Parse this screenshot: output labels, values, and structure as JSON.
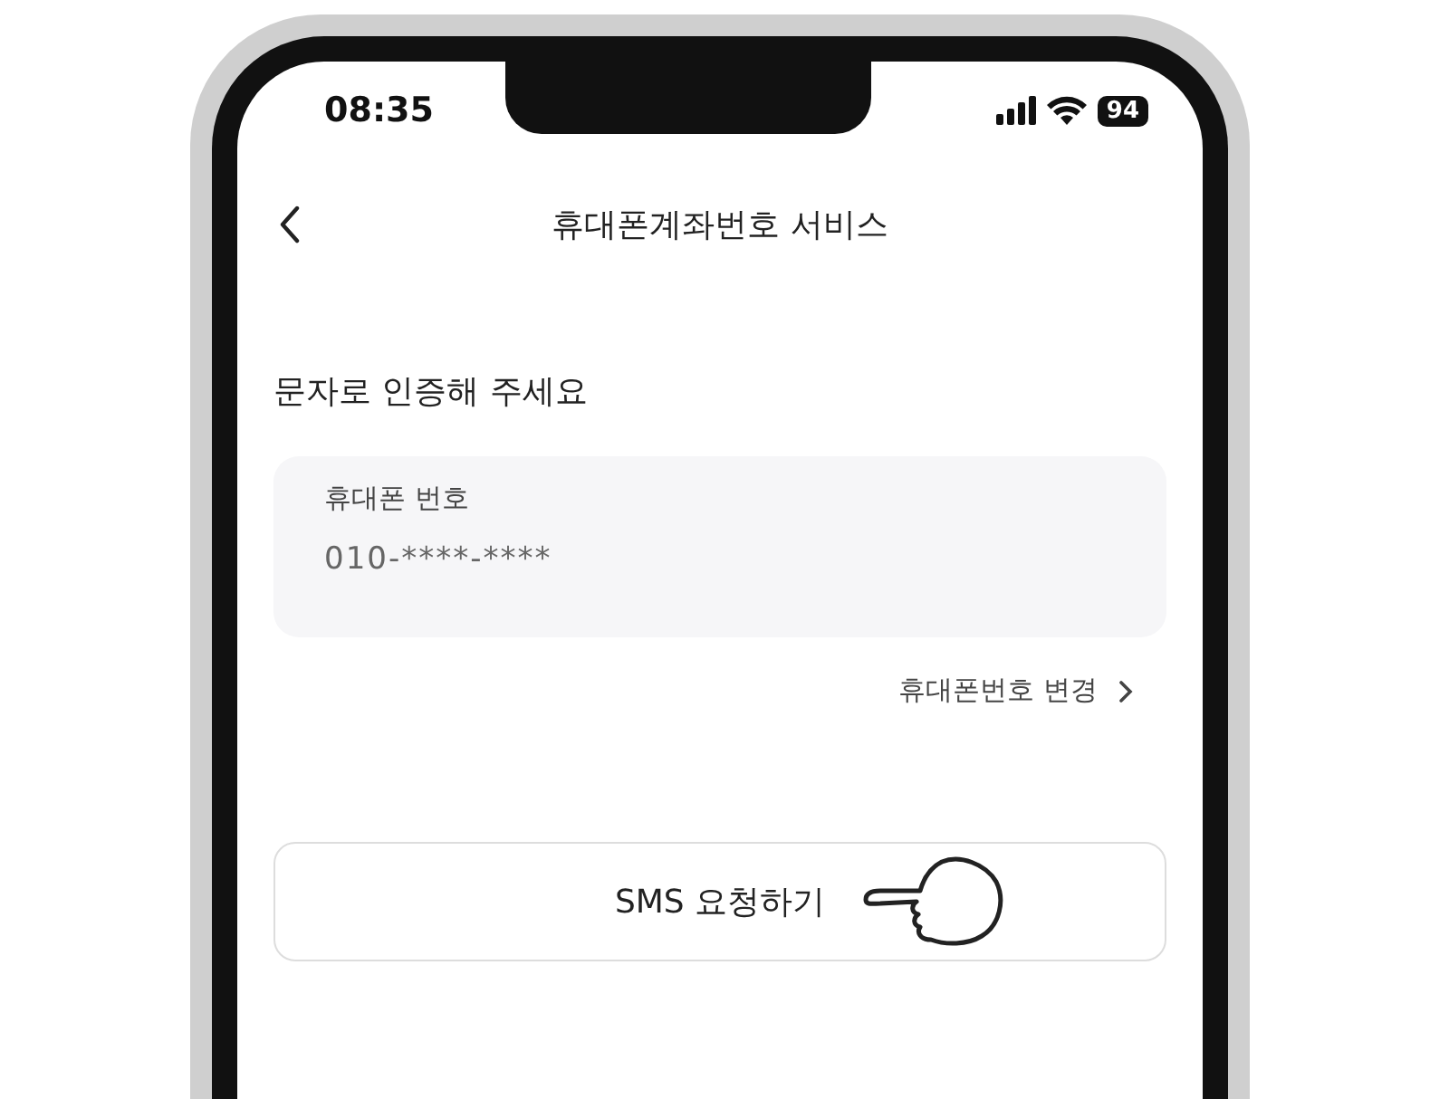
{
  "status_bar": {
    "time": "08:35",
    "battery": "94"
  },
  "header": {
    "title": "휴대폰계좌번호 서비스"
  },
  "heading": "문자로 인증해 주세요",
  "phone_field": {
    "label": "휴대폰 번호",
    "value": "010-****-****"
  },
  "change_link": "휴대폰번호 변경",
  "request_button": "SMS 요청하기"
}
